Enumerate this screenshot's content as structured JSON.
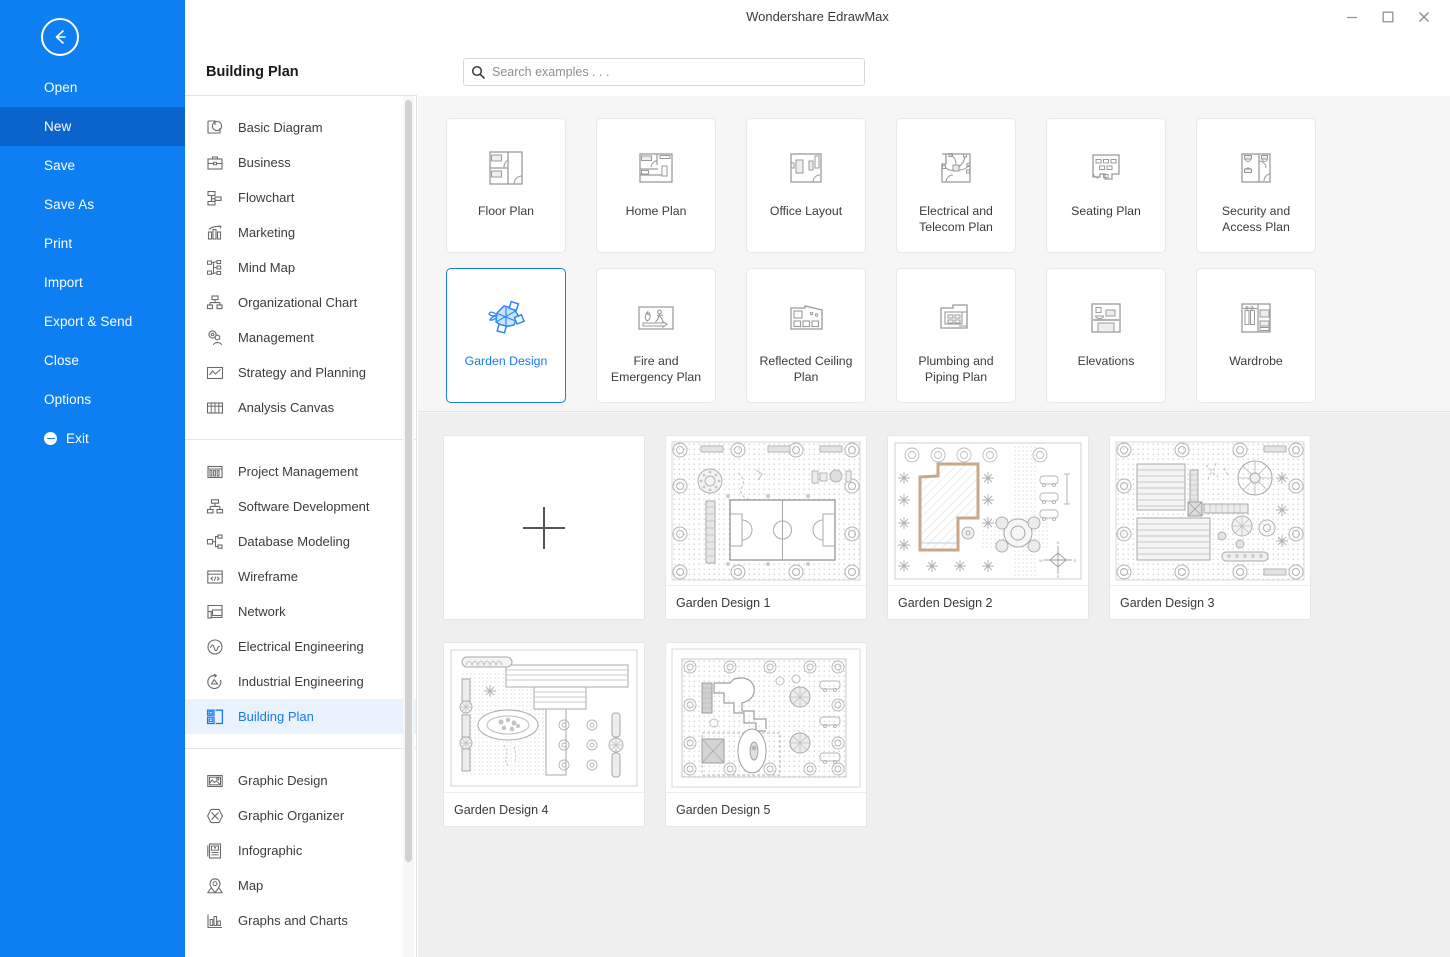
{
  "window": {
    "title": "Wondershare EdrawMax",
    "controls": [
      {
        "name": "minimize",
        "glyph": "minimize-icon"
      },
      {
        "name": "maximize",
        "glyph": "maximize-icon"
      },
      {
        "name": "close",
        "glyph": "close-icon"
      }
    ]
  },
  "colors": {
    "rail_blue": "#0d7ff2",
    "rail_active_blue": "#0b63ce",
    "accent_blue": "#1a7aea",
    "selected_bg": "#e9f2fd",
    "panel_bg": "#f6f6f6",
    "examples_bg": "#efefef",
    "card_border": "#e8e8e8"
  },
  "rail": {
    "back_icon": "arrow-left-circle-icon",
    "items": [
      {
        "label": "Open",
        "active": false
      },
      {
        "label": "New",
        "active": true
      },
      {
        "label": "Save",
        "active": false
      },
      {
        "label": "Save As",
        "active": false
      },
      {
        "label": "Print",
        "active": false
      },
      {
        "label": "Import",
        "active": false
      },
      {
        "label": "Export & Send",
        "active": false
      },
      {
        "label": "Close",
        "active": false
      },
      {
        "label": "Options",
        "active": false
      },
      {
        "label": "Exit",
        "active": false,
        "icon": "minus-circle-icon"
      }
    ]
  },
  "category_panel": {
    "header": "Building Plan",
    "groups": [
      {
        "items": [
          {
            "label": "Basic Diagram",
            "icon": "basic-diagram-icon",
            "active": false
          },
          {
            "label": "Business",
            "icon": "briefcase-icon",
            "active": false
          },
          {
            "label": "Flowchart",
            "icon": "flowchart-icon",
            "active": false
          },
          {
            "label": "Marketing",
            "icon": "bar-chart-icon",
            "active": false
          },
          {
            "label": "Mind Map",
            "icon": "mind-map-icon",
            "active": false
          },
          {
            "label": "Organizational Chart",
            "icon": "org-chart-icon",
            "active": false
          },
          {
            "label": "Management",
            "icon": "gear-person-icon",
            "active": false
          },
          {
            "label": "Strategy and Planning",
            "icon": "line-chart-icon",
            "active": false
          },
          {
            "label": "Analysis Canvas",
            "icon": "canvas-grid-icon",
            "active": false
          }
        ]
      },
      {
        "items": [
          {
            "label": "Project Management",
            "icon": "gantt-icon",
            "active": false
          },
          {
            "label": "Software Development",
            "icon": "software-tree-icon",
            "active": false
          },
          {
            "label": "Database Modeling",
            "icon": "database-nodes-icon",
            "active": false
          },
          {
            "label": "Wireframe",
            "icon": "wireframe-code-icon",
            "active": false
          },
          {
            "label": "Network",
            "icon": "network-devices-icon",
            "active": false
          },
          {
            "label": "Electrical Engineering",
            "icon": "circle-wave-icon",
            "active": false
          },
          {
            "label": "Industrial Engineering",
            "icon": "industrial-loop-icon",
            "active": false
          },
          {
            "label": "Building Plan",
            "icon": "building-plan-icon",
            "active": true
          }
        ]
      },
      {
        "items": [
          {
            "label": "Graphic Design",
            "icon": "image-frame-icon",
            "active": false
          },
          {
            "label": "Graphic Organizer",
            "icon": "hexagon-x-icon",
            "active": false
          },
          {
            "label": "Infographic",
            "icon": "infographic-icon",
            "active": false
          },
          {
            "label": "Map",
            "icon": "map-pin-icon",
            "active": false
          },
          {
            "label": "Graphs and Charts",
            "icon": "graphs-charts-icon",
            "active": false
          }
        ]
      }
    ],
    "scrollbar": {
      "name": "category-scrollbar"
    }
  },
  "search": {
    "placeholder": "Search examples . . .",
    "value": "",
    "icon": "search-icon"
  },
  "diagram_types": [
    {
      "label": "Floor Plan",
      "icon": "floor-plan-icon",
      "selected": false
    },
    {
      "label": "Home Plan",
      "icon": "home-plan-icon",
      "selected": false
    },
    {
      "label": "Office Layout",
      "icon": "office-layout-icon",
      "selected": false
    },
    {
      "label": "Electrical and Telecom Plan",
      "icon": "electrical-telecom-icon",
      "selected": false
    },
    {
      "label": "Seating Plan",
      "icon": "seating-plan-icon",
      "selected": false
    },
    {
      "label": "Security and Access Plan",
      "icon": "security-access-icon",
      "selected": false
    },
    {
      "label": "Garden Design",
      "icon": "garden-design-icon",
      "selected": true
    },
    {
      "label": "Fire and Emergency Plan",
      "icon": "fire-emergency-icon",
      "selected": false
    },
    {
      "label": "Reflected Ceiling Plan",
      "icon": "reflected-ceiling-icon",
      "selected": false
    },
    {
      "label": "Plumbing and Piping Plan",
      "icon": "plumbing-piping-icon",
      "selected": false
    },
    {
      "label": "Elevations",
      "icon": "elevations-icon",
      "selected": false
    },
    {
      "label": "Wardrobe",
      "icon": "wardrobe-icon",
      "selected": false
    }
  ],
  "examples": {
    "blank_label": "",
    "blank_icon": "plus-icon",
    "items": [
      {
        "label": "Garden Design 1",
        "thumb": "garden-1-thumb"
      },
      {
        "label": "Garden Design 2",
        "thumb": "garden-2-thumb"
      },
      {
        "label": "Garden Design 3",
        "thumb": "garden-3-thumb"
      },
      {
        "label": "Garden Design 4",
        "thumb": "garden-4-thumb"
      },
      {
        "label": "Garden Design 5",
        "thumb": "garden-5-thumb"
      }
    ]
  }
}
